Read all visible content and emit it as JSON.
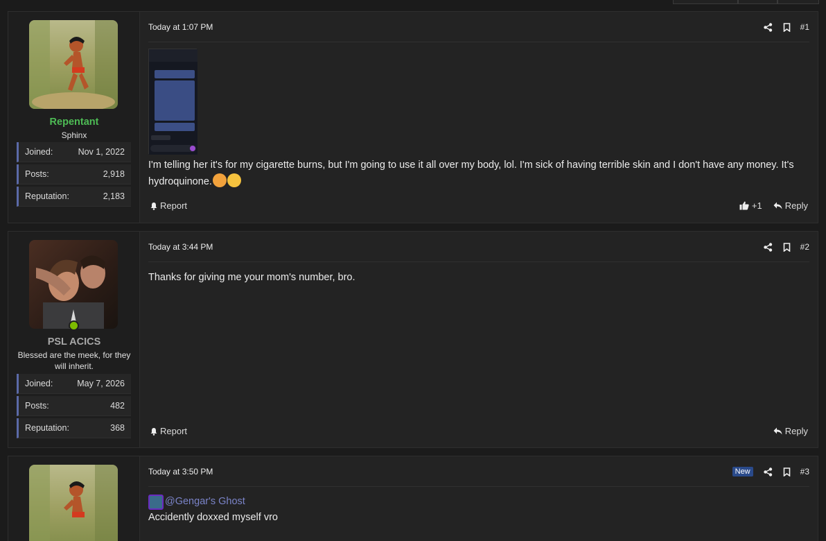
{
  "posts": [
    {
      "user": {
        "name": "Repentant",
        "name_color": "#4ebc55",
        "title": "Sphinx",
        "stats": [
          {
            "label": "Joined:",
            "value": "Nov 1, 2022"
          },
          {
            "label": "Posts:",
            "value": "2,918"
          },
          {
            "label": "Reputation:",
            "value": "2,183"
          }
        ]
      },
      "date": "Today at 1:07 PM",
      "number": "#1",
      "text": "I'm telling her it's for my cigarette burns, but I'm going to use it all over my body, lol. I'm sick of having terrible skin and I don't have any money. It's hydroquinone.",
      "report_label": "Report",
      "reaction_count": "+1",
      "reply_label": "Reply"
    },
    {
      "user": {
        "name": "PSL ACICS",
        "name_color": "#a8a8a8",
        "title": "Blessed are the meek, for they will inherit.",
        "stats": [
          {
            "label": "Joined:",
            "value": "May 7, 2026"
          },
          {
            "label": "Posts:",
            "value": "482"
          },
          {
            "label": "Reputation:",
            "value": "368"
          }
        ]
      },
      "date": "Today at 3:44 PM",
      "number": "#2",
      "text": "Thanks for giving me your mom's number, bro.",
      "report_label": "Report",
      "reply_label": "Reply"
    },
    {
      "date": "Today at 3:50 PM",
      "number": "#3",
      "badge": "New",
      "mention": "@Gengar's Ghost",
      "text": "Accidently doxxed myself vro"
    }
  ],
  "icons": {
    "share": "share-icon",
    "bookmark": "bookmark-icon",
    "report": "bell-icon",
    "like": "thumbs-up-icon",
    "reply": "reply-icon"
  },
  "colors": {
    "background": "#1b1b1b",
    "panel": "#232323",
    "accent": "#5b6aa8",
    "online": "#7dbb00",
    "mention": "#7b84c9"
  }
}
